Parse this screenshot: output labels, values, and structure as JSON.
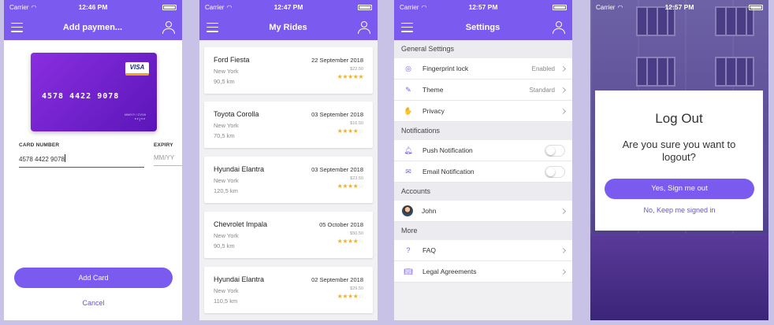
{
  "status": {
    "carrier": "Carrier",
    "wifi": "wifi-icon"
  },
  "screen1": {
    "time": "12:46 PM",
    "title": "Add paymen...",
    "card": {
      "brand": "VISA",
      "number": "4578 4422 9078",
      "small_text": "MM/YY / CVV#",
      "dots": "**/**"
    },
    "card_number_label": "CARD NUMBER",
    "card_number_value": "4578 4422 9078",
    "expiry_label": "EXPIRY",
    "expiry_placeholder": "MM/YY",
    "add_button": "Add Card",
    "cancel": "Cancel"
  },
  "screen2": {
    "time": "12:47 PM",
    "title": "My Rides",
    "rides": [
      {
        "car": "Ford Fiesta",
        "city": "New York",
        "distance": "90,5 km",
        "date": "22 September 2018",
        "price": "$22.50",
        "rating": 5
      },
      {
        "car": "Toyota Corolla",
        "city": "New York",
        "distance": "70,5 km",
        "date": "03 September 2018",
        "price": "$16.50",
        "rating": 3.5
      },
      {
        "car": "Hyundai Elantra",
        "city": "New York",
        "distance": "120,5 km",
        "date": "03 September 2018",
        "price": "$23.50",
        "rating": 4
      },
      {
        "car": "Chevrolet Impala",
        "city": "New York",
        "distance": "90,5 km",
        "date": "05 October 2018",
        "price": "$50.50",
        "rating": 4
      },
      {
        "car": "Hyundai Elantra",
        "city": "New York",
        "distance": "110,5 km",
        "date": "02 September 2018",
        "price": "$29.50",
        "rating": 3.5
      }
    ]
  },
  "screen3": {
    "time": "12:57 PM",
    "title": "Settings",
    "sections": {
      "general": "General Settings",
      "notifications": "Notifications",
      "accounts": "Accounts",
      "more": "More"
    },
    "fingerprint": {
      "label": "Fingerprint lock",
      "value": "Enabled"
    },
    "theme": {
      "label": "Theme",
      "value": "Standard"
    },
    "privacy": {
      "label": "Privacy"
    },
    "push": {
      "label": "Push Notification",
      "on": false
    },
    "email": {
      "label": "Email Notification",
      "on": false
    },
    "account": {
      "name": "John"
    },
    "faq": {
      "label": "FAQ"
    },
    "legal": {
      "label": "Legal Agreements"
    }
  },
  "screen4": {
    "time": "12:57 PM",
    "modal_title": "Log Out",
    "question": "Are you sure you want to logout?",
    "confirm": "Yes, Sign me out",
    "keep": "No, Keep me signed in"
  },
  "colors": {
    "accent": "#7b5af0",
    "star": "#f0b324"
  }
}
